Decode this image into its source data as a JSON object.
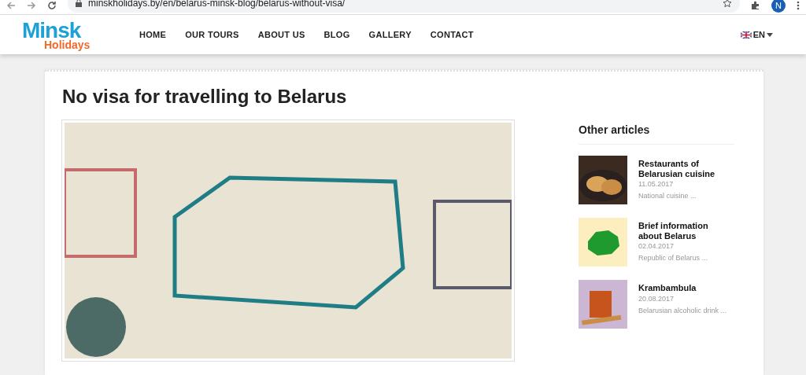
{
  "browser": {
    "url": "minskholidays.by/en/belarus-minsk-blog/belarus-without-visa/",
    "profile_initial": "N"
  },
  "header": {
    "logo": {
      "top": "Minsk",
      "bottom": "Holidays"
    },
    "nav": [
      {
        "label": "HOME"
      },
      {
        "label": "OUR TOURS"
      },
      {
        "label": "ABOUT US"
      },
      {
        "label": "BLOG"
      },
      {
        "label": "GALLERY"
      },
      {
        "label": "CONTACT"
      }
    ],
    "language": "EN"
  },
  "article": {
    "title": "No visa for travelling to Belarus"
  },
  "sidebar": {
    "heading": "Other articles",
    "items": [
      {
        "title": "Restaurants of Belarusian cuisine",
        "date": "11.05.2017",
        "excerpt": "National cuisine ...",
        "kind": "food"
      },
      {
        "title": "Brief information about Belarus",
        "date": "02.04.2017",
        "excerpt": "Republic of Belarus ...",
        "kind": "map"
      },
      {
        "title": "Krambambula",
        "date": "20.08.2017",
        "excerpt": "Belarusian alcoholic drink ...",
        "kind": "drink"
      }
    ]
  }
}
